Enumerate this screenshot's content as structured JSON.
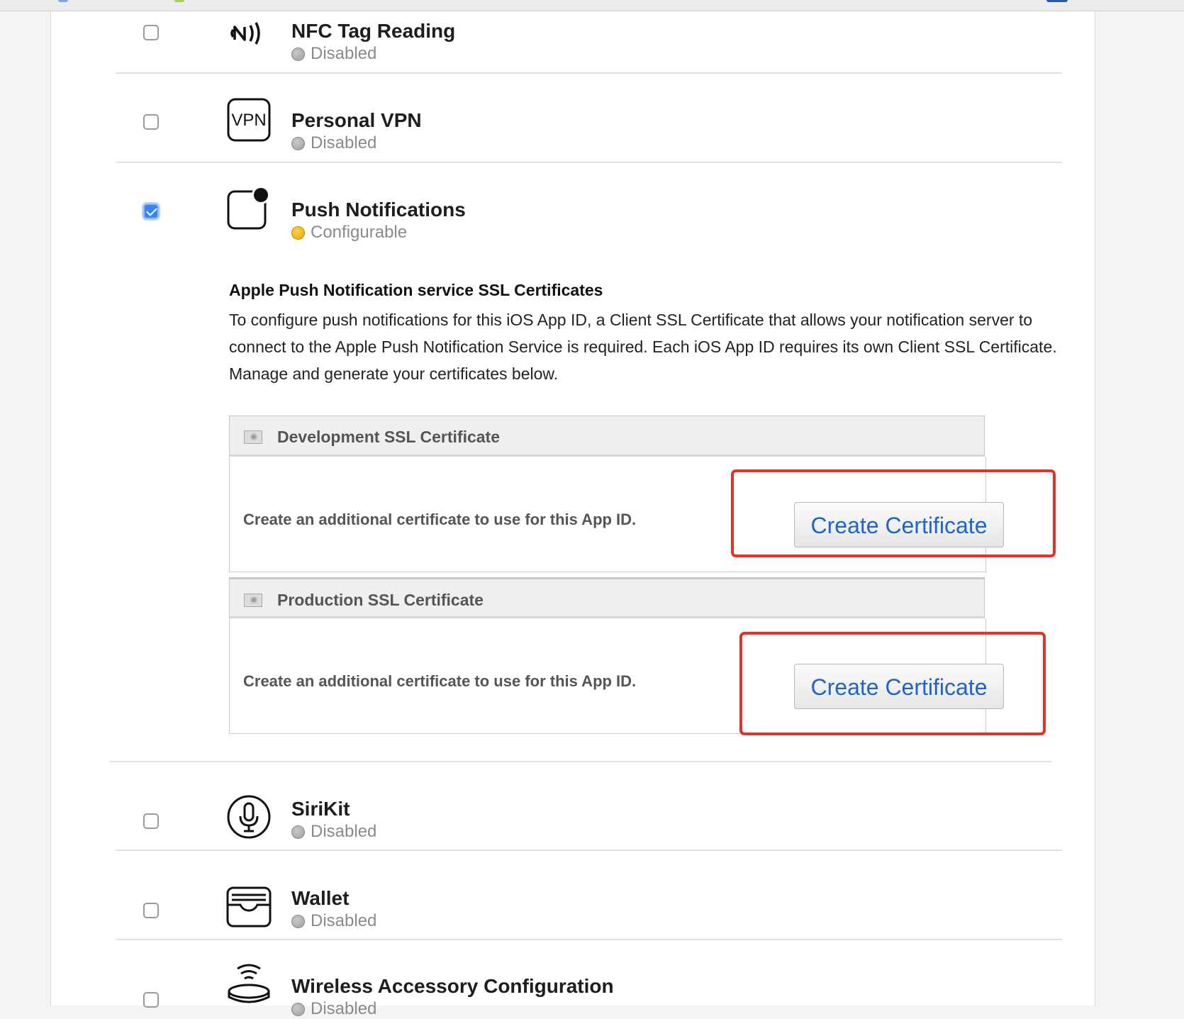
{
  "capabilities": [
    {
      "name": "NFC Tag Reading",
      "status": "Disabled",
      "checked": false,
      "icon": "nfc-icon"
    },
    {
      "name": "Personal VPN",
      "status": "Disabled",
      "checked": false,
      "icon": "vpn-icon",
      "icon_text": "VPN"
    },
    {
      "name": "Push Notifications",
      "status": "Configurable",
      "checked": true,
      "icon": "push-notification-icon"
    },
    {
      "name": "SiriKit",
      "status": "Disabled",
      "checked": false,
      "icon": "microphone-icon"
    },
    {
      "name": "Wallet",
      "status": "Disabled",
      "checked": false,
      "icon": "wallet-icon"
    },
    {
      "name": "Wireless Accessory Configuration",
      "status": "Disabled",
      "checked": false,
      "icon": "wireless-accessory-icon"
    }
  ],
  "apns": {
    "title": "Apple Push Notification service SSL Certificates",
    "description": "To configure push notifications for this iOS App ID, a Client SSL Certificate that allows your notification server to connect to the Apple Push Notification Service is required. Each iOS App ID requires its own Client SSL Certificate. Manage and generate your certificates below.",
    "development": {
      "title": "Development SSL Certificate",
      "text": "Create an additional certificate to use for this App ID.",
      "button": "Create Certificate"
    },
    "production": {
      "title": "Production SSL Certificate",
      "text": "Create an additional certificate to use for this App ID.",
      "button": "Create Certificate"
    }
  },
  "colors": {
    "status_disabled": "#9b9b9b",
    "status_configurable": "#e2a400",
    "checkbox_checked": "#3b82f6",
    "button_text": "#1f64c6",
    "annotation": "#e53322"
  }
}
